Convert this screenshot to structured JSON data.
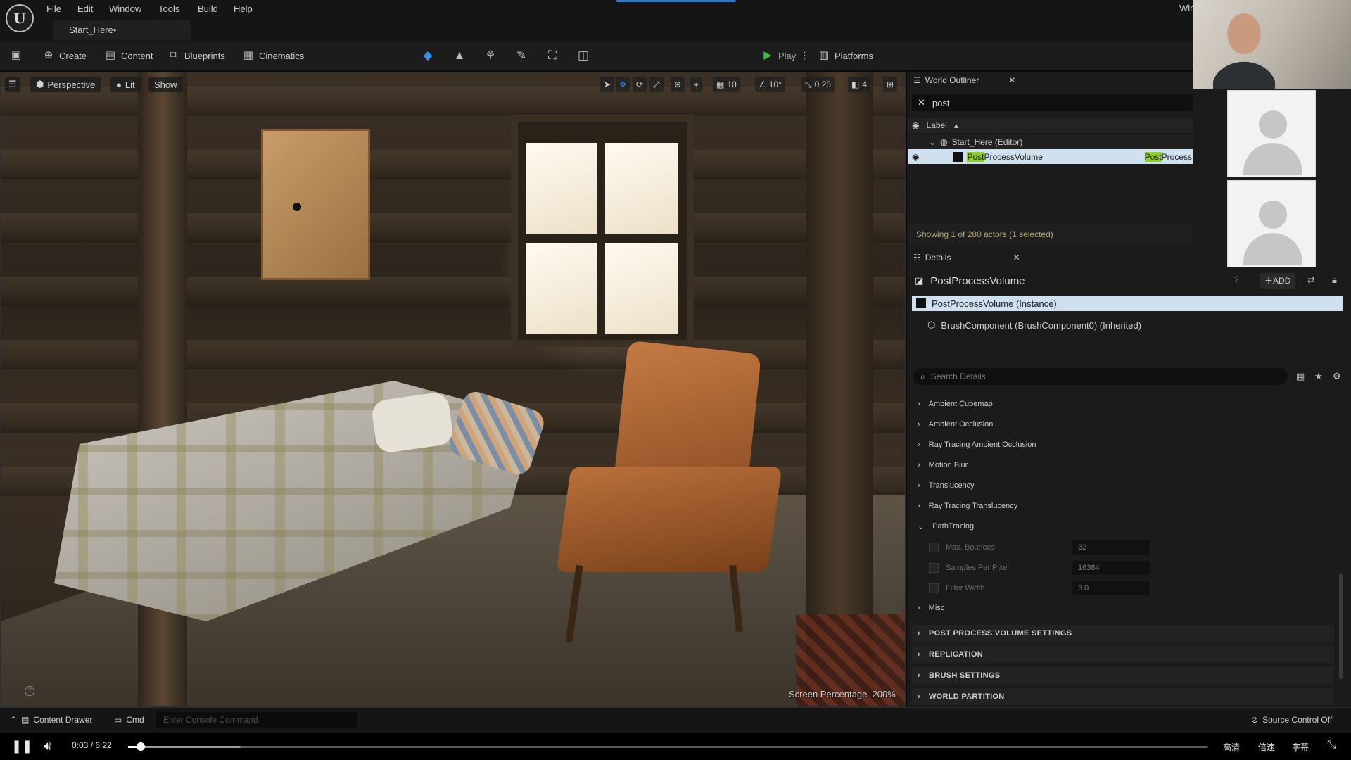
{
  "menubar": {
    "items": [
      "File",
      "Edit",
      "Window",
      "Tools",
      "Build",
      "Help"
    ],
    "document_tab": "Start_Here•",
    "window_truncated": "Win"
  },
  "toolbar": {
    "create": "Create",
    "content": "Content",
    "blueprints": "Blueprints",
    "cinematics": "Cinematics",
    "play": "Play",
    "platforms": "Platforms"
  },
  "viewport": {
    "perspective": "Perspective",
    "lit": "Lit",
    "show": "Show",
    "grid_snap": "10",
    "rotation_snap": "10°",
    "scale_snap": "0.25",
    "camera_speed": "4",
    "screen_percentage_label": "Screen Percentage",
    "screen_percentage_value": "200%"
  },
  "outliner": {
    "tab_label": "World Outliner",
    "search_value": "post",
    "column_label": "Label",
    "world_item": "Start_Here (Editor)",
    "actor_highlight": "Post",
    "actor_rest": "ProcessVolume",
    "actor_type_highlight": "Post",
    "actor_type_rest": "Process",
    "status": "Showing 1 of 280 actors (1 selected)"
  },
  "details": {
    "tab_label": "Details",
    "title": "PostProcessVolume",
    "add_label": "ADD",
    "instance_component": "PostProcessVolume (Instance)",
    "brush_component": "BrushComponent (BrushComponent0) (Inherited)",
    "search_placeholder": "Search Details",
    "categories": [
      "Ambient Cubemap",
      "Ambient Occlusion",
      "Ray Tracing Ambient Occlusion",
      "Motion Blur",
      "Translucency",
      "Ray Tracing Translucency",
      "PathTracing"
    ],
    "path_tracing_props": [
      {
        "name": "Max. Bounces",
        "value": "32"
      },
      {
        "name": "Samples Per Pixel",
        "value": "16384"
      },
      {
        "name": "Filter Width",
        "value": "3.0"
      }
    ],
    "misc": "Misc",
    "sections": [
      "POST PROCESS VOLUME SETTINGS",
      "REPLICATION",
      "BRUSH SETTINGS",
      "WORLD PARTITION"
    ]
  },
  "statusbar": {
    "content_drawer": "Content Drawer",
    "cmd": "Cmd",
    "console_placeholder": "Enter Console Command",
    "source_control": "Source Control Off"
  },
  "player": {
    "time": "0:03 / 6:22",
    "progress_fraction": 0.008,
    "quality": "高清",
    "speed": "倍速",
    "subtitles": "字幕"
  },
  "colors": {
    "selection": "#cfe0ee",
    "highlight": "#90d02c",
    "play_green": "#3fbf3f",
    "accent_blue": "#2a7cc9"
  }
}
